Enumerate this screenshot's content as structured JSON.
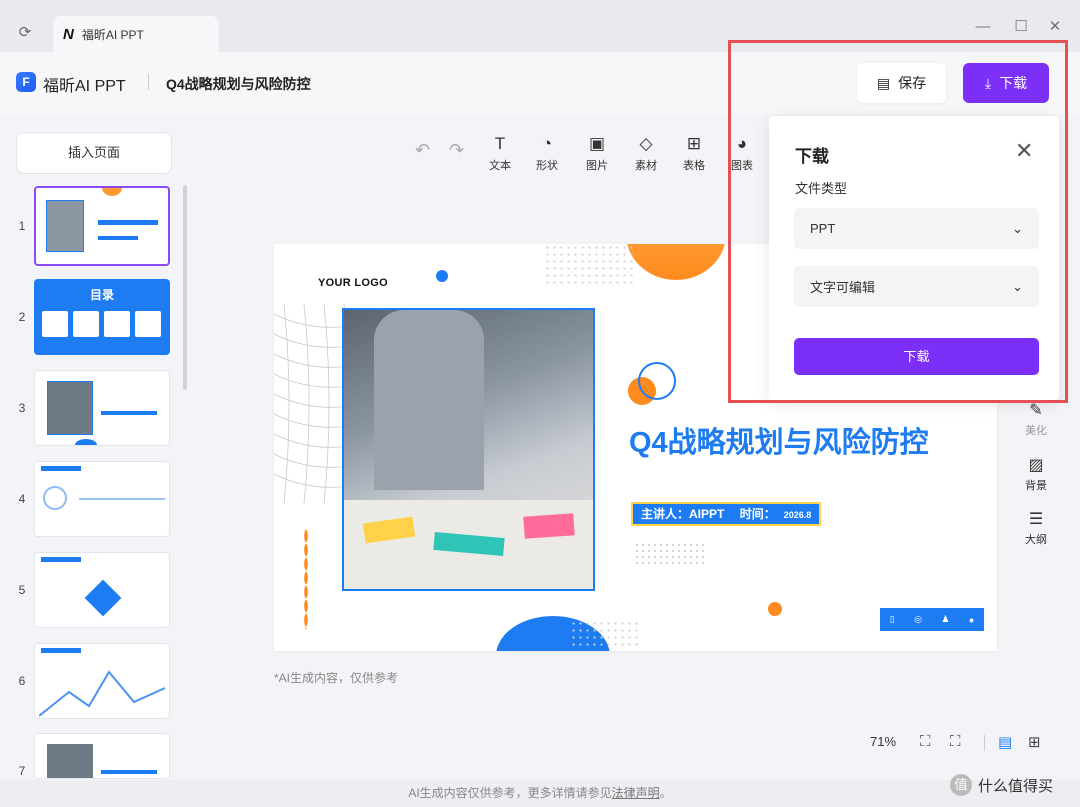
{
  "window": {
    "tab_title": "福昕AI PPT",
    "tab_logo": "N"
  },
  "header": {
    "app_name": "福昕AI PPT",
    "doc_title": "Q4战略规划与风险防控",
    "save_label": "保存",
    "download_label": "下载"
  },
  "sidebar": {
    "insert_label": "插入页面",
    "thumb_numbers": [
      "1",
      "2",
      "3",
      "4",
      "5",
      "6",
      "7"
    ],
    "thumb2_title": "目录"
  },
  "toolbar": {
    "items": [
      {
        "label": "文本",
        "icon": "text-icon"
      },
      {
        "label": "形状",
        "icon": "shape-icon"
      },
      {
        "label": "图片",
        "icon": "image-icon"
      },
      {
        "label": "素材",
        "icon": "material-icon"
      },
      {
        "label": "表格",
        "icon": "table-icon"
      },
      {
        "label": "图表",
        "icon": "chart-icon"
      }
    ]
  },
  "slide": {
    "logo": "YOUR LOGO",
    "title": "Q4战略规划与风险防控",
    "presenter": "主讲人：AIPPT",
    "time_label": "时间：",
    "time_value": "2026.8"
  },
  "disclaimer": "*AI生成内容，仅供参考",
  "right_tools": [
    {
      "label": "美化",
      "icon": "beautify-icon"
    },
    {
      "label": "背景",
      "icon": "background-icon"
    },
    {
      "label": "大纲",
      "icon": "outline-icon"
    }
  ],
  "bottom": {
    "zoom": "71%"
  },
  "footer": {
    "text": "AI生成内容仅供参考，更多详情请参见",
    "link": "法律声明",
    "suffix": "。"
  },
  "watermark": {
    "text": "什么值得买",
    "badge": "值"
  },
  "download_popup": {
    "title": "下载",
    "file_type_label": "文件类型",
    "format_value": "PPT",
    "mode_value": "文字可编辑",
    "confirm_label": "下载"
  },
  "colors": {
    "accent_purple": "#7b2ff7",
    "slide_blue": "#1e7cf2",
    "highlight_red": "#e55152"
  }
}
